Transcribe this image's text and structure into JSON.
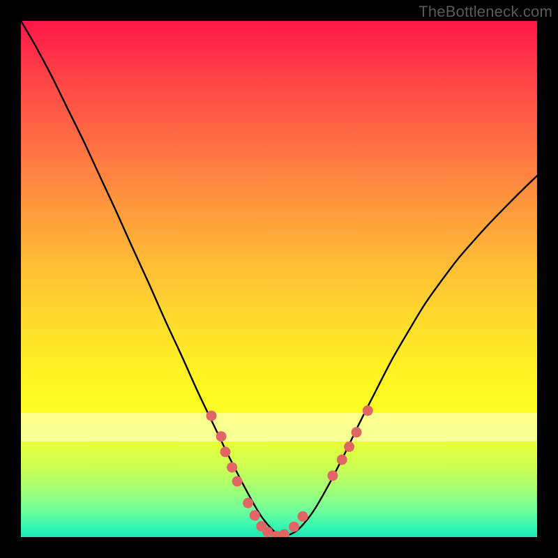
{
  "watermark": "TheBottleneck.com",
  "chart_data": {
    "type": "line",
    "title": "",
    "xlabel": "",
    "ylabel": "",
    "xlim": [
      0,
      1
    ],
    "ylim": [
      0,
      1
    ],
    "note": "Axes are unlabeled in the image; x/y are normalized 0–1 across the plot area. Curve depicts a bottleneck V-shape with minimum near x≈0.48.",
    "series": [
      {
        "name": "bottleneck-curve",
        "x": [
          0.0,
          0.028,
          0.059,
          0.09,
          0.122,
          0.153,
          0.185,
          0.216,
          0.248,
          0.279,
          0.311,
          0.342,
          0.374,
          0.405,
          0.437,
          0.468,
          0.5,
          0.531,
          0.563,
          0.594,
          0.626,
          0.657,
          0.689,
          0.72,
          0.752,
          0.783,
          0.815,
          0.846,
          0.878,
          0.909,
          0.941,
          0.972,
          1.0
        ],
        "y": [
          1.0,
          0.952,
          0.894,
          0.831,
          0.766,
          0.699,
          0.63,
          0.561,
          0.491,
          0.421,
          0.352,
          0.283,
          0.216,
          0.152,
          0.09,
          0.037,
          0.005,
          0.01,
          0.045,
          0.097,
          0.159,
          0.223,
          0.286,
          0.346,
          0.401,
          0.452,
          0.497,
          0.538,
          0.575,
          0.609,
          0.642,
          0.673,
          0.7
        ]
      }
    ],
    "markers": [
      {
        "x": 0.369,
        "y": 0.235
      },
      {
        "x": 0.388,
        "y": 0.195
      },
      {
        "x": 0.396,
        "y": 0.165
      },
      {
        "x": 0.409,
        "y": 0.135
      },
      {
        "x": 0.419,
        "y": 0.108
      },
      {
        "x": 0.44,
        "y": 0.066
      },
      {
        "x": 0.453,
        "y": 0.042
      },
      {
        "x": 0.466,
        "y": 0.021
      },
      {
        "x": 0.478,
        "y": 0.01
      },
      {
        "x": 0.495,
        "y": 0.002
      },
      {
        "x": 0.51,
        "y": 0.005
      },
      {
        "x": 0.529,
        "y": 0.02
      },
      {
        "x": 0.546,
        "y": 0.04
      },
      {
        "x": 0.604,
        "y": 0.119
      },
      {
        "x": 0.622,
        "y": 0.15
      },
      {
        "x": 0.636,
        "y": 0.175
      },
      {
        "x": 0.65,
        "y": 0.203
      },
      {
        "x": 0.672,
        "y": 0.245
      }
    ],
    "marker_color": "#e06666",
    "curve_color": "#000000",
    "pale_band": {
      "top": 0.759,
      "bottom": 0.815
    }
  }
}
